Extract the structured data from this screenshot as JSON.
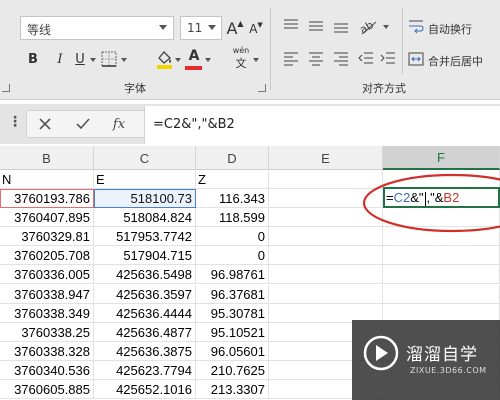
{
  "ribbon": {
    "font_name": "等线",
    "font_size": "11",
    "grow_font": "A",
    "shrink_font": "A",
    "bold": "B",
    "italic": "I",
    "underline": "U",
    "phonetic_top": "wén",
    "phonetic_bottom": "文",
    "font_group_label": "字体",
    "alignment_group_label": "对齐方式",
    "wrap_text": "自动换行",
    "merge_center": "合并后居中"
  },
  "formula_bar": {
    "fx_label": "fx",
    "formula": "=C2&\",\"&B2"
  },
  "columns": [
    {
      "label": "B"
    },
    {
      "label": "C"
    },
    {
      "label": "D"
    },
    {
      "label": "E"
    },
    {
      "label": "F",
      "selected": true
    }
  ],
  "header_row": {
    "a_fragment": "N",
    "c_fragment": "E",
    "d_fragment": "Z"
  },
  "rows": [
    {
      "b": "3760193.786",
      "c": "518100.73",
      "d": "116.343"
    },
    {
      "b": "3760407.895",
      "c": "518084.824",
      "d": "118.599"
    },
    {
      "b": "3760329.81",
      "c": "517953.7742",
      "d": "0"
    },
    {
      "b": "3760205.708",
      "c": "517904.715",
      "d": "0"
    },
    {
      "b": "3760336.005",
      "c": "425636.5498",
      "d": "96.98761"
    },
    {
      "b": "3760338.947",
      "c": "425636.3597",
      "d": "96.37681"
    },
    {
      "b": "3760338.349",
      "c": "425636.4444",
      "d": "95.30781"
    },
    {
      "b": "3760338.25",
      "c": "425636.4877",
      "d": "95.10521"
    },
    {
      "b": "3760338.328",
      "c": "425636.3875",
      "d": "96.05601"
    },
    {
      "b": "3760340.536",
      "c": "425623.7794",
      "d": "210.7625"
    },
    {
      "b": "3760605.885",
      "c": "425652.1016",
      "d": "213.3307"
    }
  ],
  "edit_cell": {
    "prefix": "=",
    "ref_c": "C2",
    "mid": "&\"",
    "after_caret": ",\"&",
    "ref_b": "B2"
  },
  "watermark": {
    "title": "溜溜自学",
    "url": "ZIXUE.3D66.COM"
  },
  "colors": {
    "excel_green": "#217346",
    "annotation_red": "#d0302a",
    "ref_blue": "#3a6bbf",
    "ref_red": "#c0392b"
  }
}
